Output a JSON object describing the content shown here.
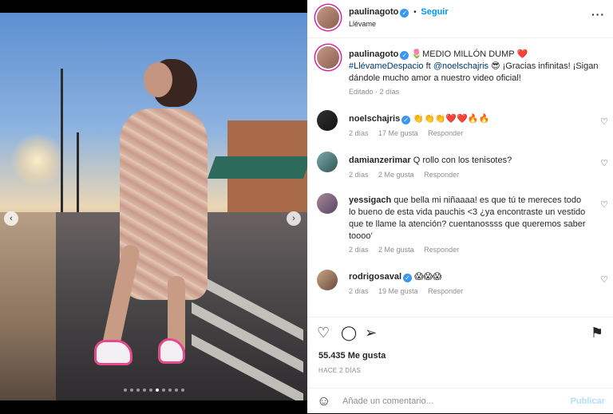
{
  "post": {
    "author": "paulinagoto",
    "follow_label": "Seguir",
    "location": "Llévame",
    "more_icon": "more-dots-icon"
  },
  "caption": {
    "author": "paulinagoto",
    "text_1": "🌷MEDIO MILLÓN DUMP ❤️",
    "hashtag": "#LlévameDespacio",
    "ft": "ft",
    "mention": "@noelschajris",
    "text_2": "😎 ¡Gracias infinitas! ¡Sigan dándole mucho amor a nuestro video oficial!",
    "edited": "Editado",
    "dot": "·",
    "time": "2 días"
  },
  "comments": [
    {
      "user": "noelschajris",
      "verified": true,
      "text": "👏👏👏❤️❤️🔥🔥",
      "time": "2 días",
      "likes": "17 Me gusta",
      "reply": "Responder"
    },
    {
      "user": "damianzerimar",
      "verified": false,
      "text": "Q rollo con los tenisotes?",
      "time": "2 días",
      "likes": "2 Me gusta",
      "reply": "Responder"
    },
    {
      "user": "yessigach",
      "verified": false,
      "text": "que bella mi niñaaaa! es que tú te mereces todo lo bueno de esta vida pauchis <3 ¿ya encontraste un vestido que te llame la atención? cuentanossss que queremos saber toooo’",
      "time": "2 días",
      "likes": "2 Me gusta",
      "reply": "Responder"
    },
    {
      "user": "rodrigosaval",
      "verified": true,
      "text": "😱😱😱",
      "time": "2 días",
      "likes": "19 Me gusta",
      "reply": "Responder"
    }
  ],
  "actions": {
    "like_icon": "heart-icon",
    "comment_icon": "comment-icon",
    "share_icon": "share-icon",
    "save_icon": "bookmark-icon",
    "likes": "55.435 Me gusta",
    "date": "HACE 2 DÍAS"
  },
  "add_comment": {
    "emoji_icon": "emoji-icon",
    "placeholder": "Añade un comentario...",
    "post_label": "Publicar"
  },
  "carousel": {
    "total": 10,
    "active": 5
  }
}
